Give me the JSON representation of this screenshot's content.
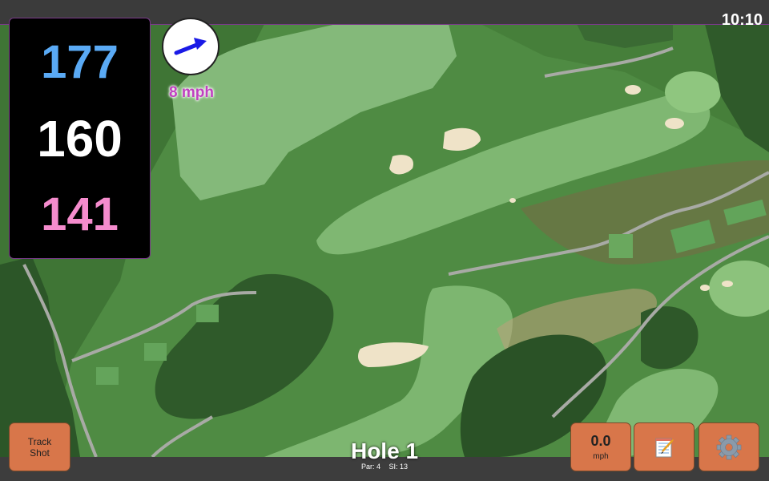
{
  "status": {
    "clock": "10:10"
  },
  "distances": {
    "back": "177",
    "middle": "160",
    "front": "141",
    "colors": {
      "back": "#5aaaf5",
      "middle": "#ffffff",
      "front": "#f58ccd"
    }
  },
  "wind": {
    "speed_label": "8 mph",
    "icon": "arrow-right-icon",
    "arrow_color": "#1a1ae6",
    "label_color": "#c040c0"
  },
  "buttons": {
    "track_shot": "Track Shot",
    "shot_speed_value": "0.0",
    "shot_speed_unit": "mph",
    "notes_icon": "notepad-icon",
    "settings_icon": "gear-icon",
    "color": "#d8764a"
  },
  "hole": {
    "title": "Hole 1",
    "par": "Par: 4",
    "si": "SI: 13"
  },
  "colors": {
    "topbar": "#3b3b3b",
    "fairway": "#6aa860",
    "rough": "#4a8a3e",
    "bunker": "#efe3c8",
    "trees": "#2f5a2a"
  }
}
